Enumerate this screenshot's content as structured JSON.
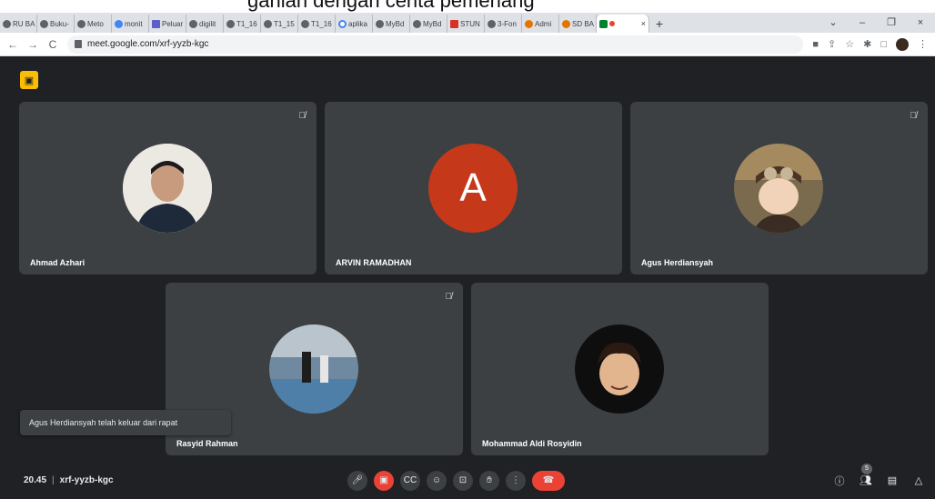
{
  "caption_fragment": "ganlah dengan cerita pemenang",
  "browser": {
    "tabs": [
      {
        "label": "RU BA"
      },
      {
        "label": "Buku-"
      },
      {
        "label": "Meto"
      },
      {
        "label": "monit"
      },
      {
        "label": "Peluar"
      },
      {
        "label": "digilit"
      },
      {
        "label": "T1_16"
      },
      {
        "label": "T1_15"
      },
      {
        "label": "T1_16"
      },
      {
        "label": "aplika"
      },
      {
        "label": "MyBd"
      },
      {
        "label": "MyBd"
      },
      {
        "label": "STUN"
      },
      {
        "label": "3-Fon"
      },
      {
        "label": "Admi"
      },
      {
        "label": "SD BA"
      }
    ],
    "active_tab_close": "×",
    "new_tab": "+",
    "window_controls": [
      "⌄",
      "–",
      "❐",
      "×"
    ],
    "address": "meet.google.com/xrf-yyzb-kgc"
  },
  "meet": {
    "participants": [
      {
        "name": "Ahmad Azhari",
        "muted": true,
        "avatar": "photo",
        "color": "#e8e3dc"
      },
      {
        "name": "ARVIN RAMADHAN",
        "muted": false,
        "avatar": "letter",
        "letter": "A",
        "color": "#c5391a"
      },
      {
        "name": "Agus Herdiansyah",
        "muted": true,
        "avatar": "photo",
        "color": "#6b5440"
      },
      {
        "name": "Rasyid Rahman",
        "muted": true,
        "avatar": "photo",
        "color": "#8fa7b8"
      },
      {
        "name": "Mohammad Aldi Rosyidin",
        "muted": false,
        "avatar": "photo",
        "color": "#111111"
      }
    ],
    "toast": "Agus Herdiansyah telah keluar dari rapat",
    "time": "20.45",
    "meeting_code": "xrf-yyzb-kgc",
    "participant_count": "5"
  }
}
